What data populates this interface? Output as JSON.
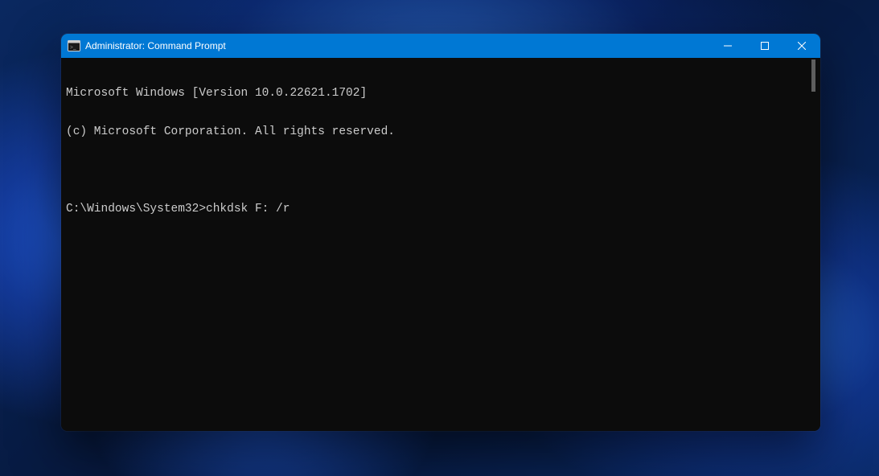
{
  "window": {
    "title": "Administrator: Command Prompt",
    "titlebar_color": "#0078d4",
    "background_color": "#0c0c0c",
    "text_color": "#cccccc"
  },
  "terminal": {
    "line1": "Microsoft Windows [Version 10.0.22621.1702]",
    "line2": "(c) Microsoft Corporation. All rights reserved.",
    "prompt": "C:\\Windows\\System32>",
    "command": "chkdsk F: /r"
  }
}
